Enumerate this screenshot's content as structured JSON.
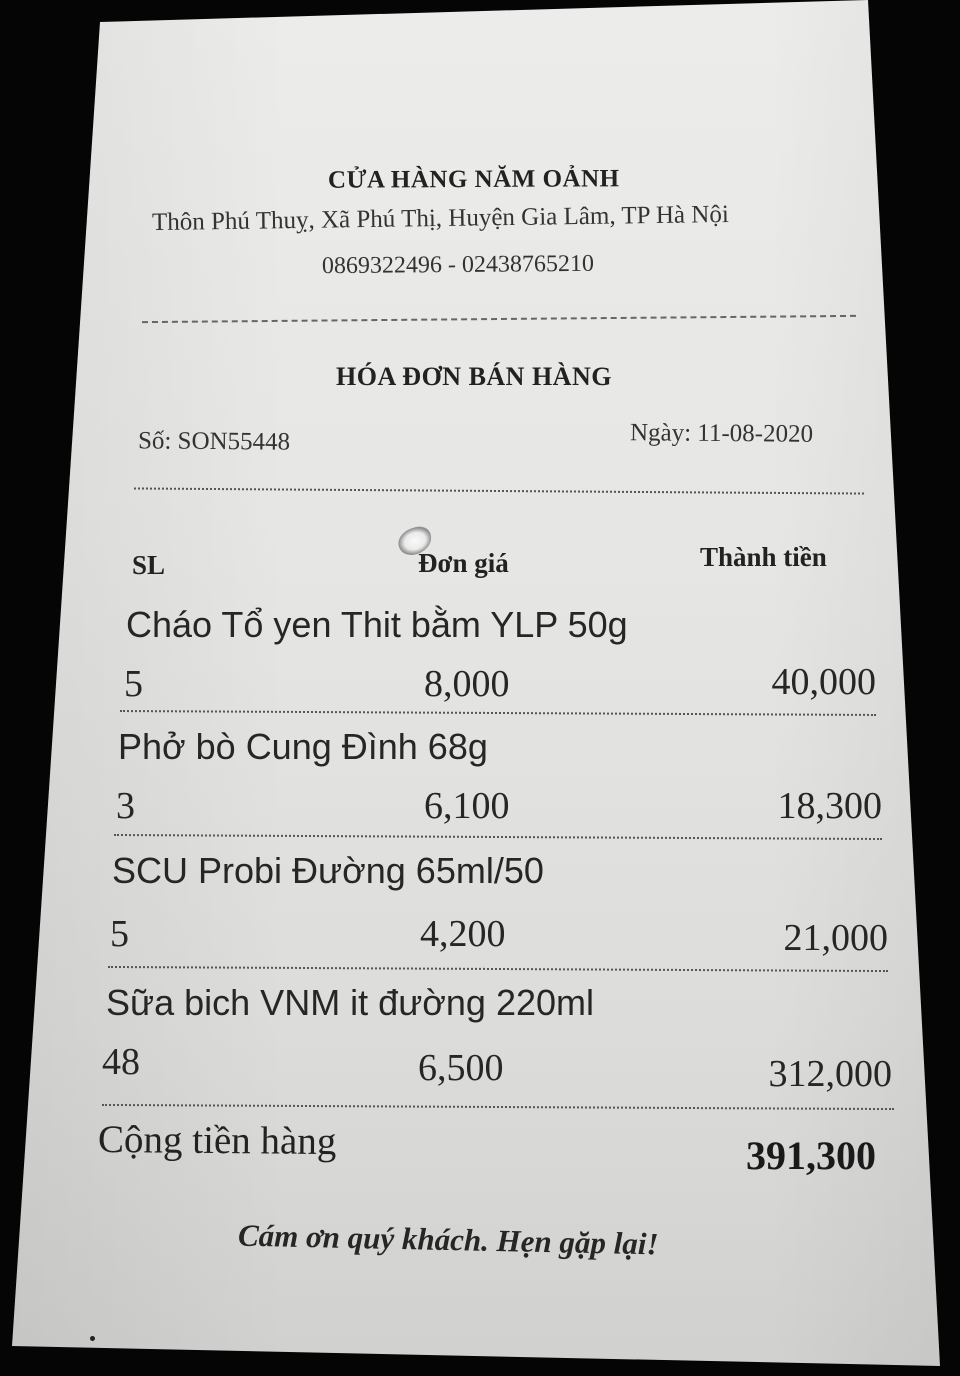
{
  "store": {
    "name": "CỬA HÀNG NĂM OẢNH",
    "address": "Thôn Phú Thuỵ, Xã Phú Thị, Huyện Gia Lâm, TP Hà Nội",
    "phone": "0869322496 - 02438765210"
  },
  "invoice": {
    "title": "HÓA ĐƠN BÁN HÀNG",
    "number_label": "Số: SON55448",
    "date_label": "Ngày: 11-08-2020"
  },
  "columns": {
    "qty": "SL",
    "unit_price": "Đơn giá",
    "line_total": "Thành tiền"
  },
  "items": [
    {
      "name": "Cháo Tổ yen Thit bằm YLP 50g",
      "qty": "5",
      "unit_price": "8,000",
      "total": "40,000"
    },
    {
      "name": "Phở bò Cung Đình 68g",
      "qty": "3",
      "unit_price": "6,100",
      "total": "18,300"
    },
    {
      "name": "SCU Probi Đường 65ml/50",
      "qty": "5",
      "unit_price": "4,200",
      "total": "21,000"
    },
    {
      "name": "Sữa bich VNM it đường 220ml",
      "qty": "48",
      "unit_price": "6,500",
      "total": "312,000"
    }
  ],
  "summary": {
    "label": "Cộng tiền hàng",
    "value": "391,300"
  },
  "footer": {
    "thanks": "Cám ơn quý khách. Hẹn gặp lại!"
  },
  "colors": {
    "paper": "#e6e6e4",
    "ink": "#222222",
    "background": "#050505"
  }
}
